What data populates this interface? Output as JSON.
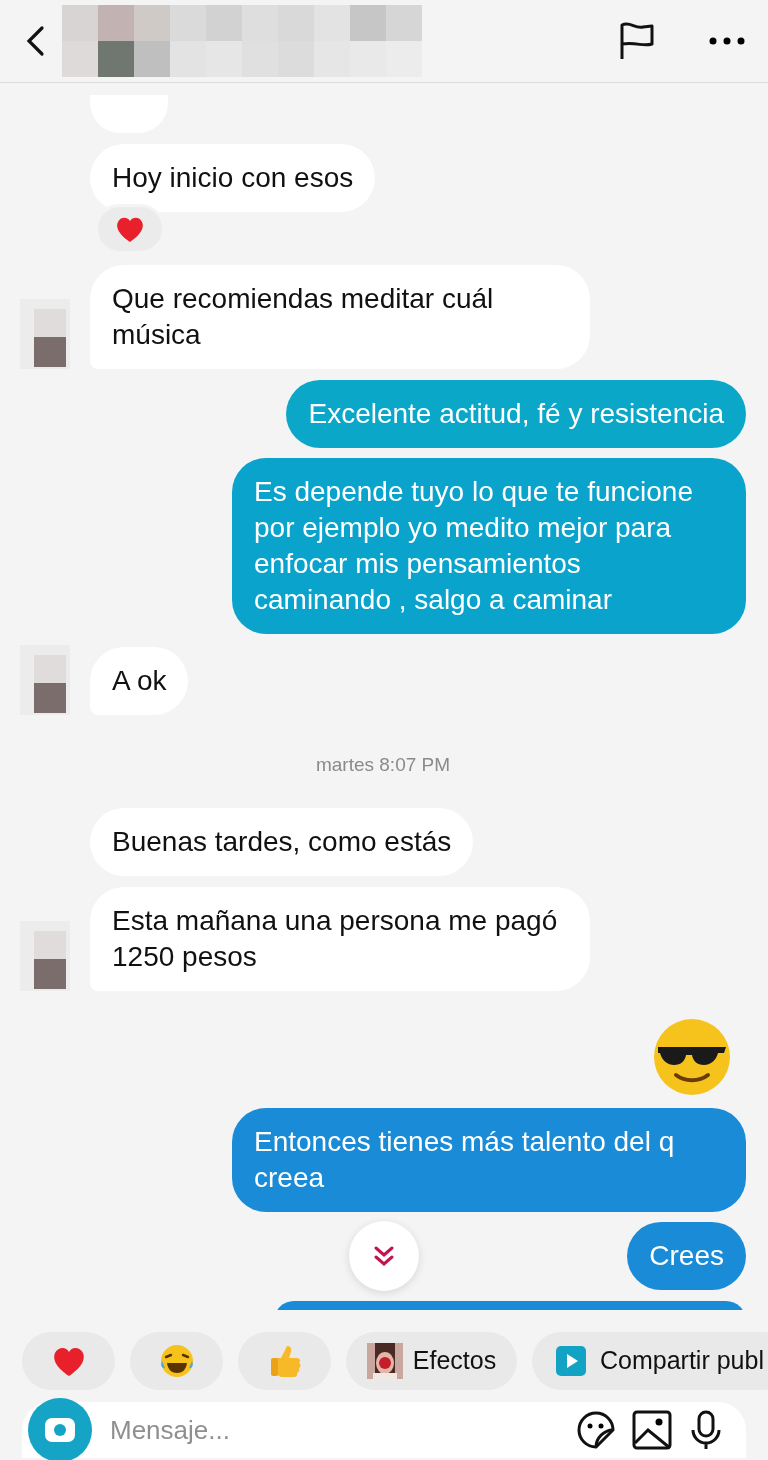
{
  "messages": [
    {
      "kind": "incoming-fragment"
    },
    {
      "kind": "incoming",
      "text": "Hoy inicio con esos",
      "avatar": false,
      "reaction": true
    },
    {
      "kind": "incoming",
      "text": "Que recomiendas meditar cuál música",
      "avatar": true,
      "reaction": false
    },
    {
      "kind": "outgoing",
      "text": "Excelente actitud, fé y resistencia",
      "color": "#0ba7c9"
    },
    {
      "kind": "outgoing",
      "text": "Es depende tuyo lo que te funcione por ejemplo yo medito mejor para enfocar mis pensamientos caminando , salgo a caminar",
      "color": "#0aa3cc"
    },
    {
      "kind": "incoming",
      "text": "A ok",
      "avatar": true,
      "reaction": false
    },
    {
      "kind": "timestamp",
      "text": "martes 8:07 PM"
    },
    {
      "kind": "incoming",
      "text": "Buenas tardes, como estás",
      "avatar": false,
      "reaction": false
    },
    {
      "kind": "incoming",
      "text": "Esta mañana una persona me pagó 1250 pesos",
      "avatar": true,
      "reaction": false
    },
    {
      "kind": "emoji"
    },
    {
      "kind": "outgoing",
      "text": "Entonces tienes más talento del q creea",
      "color": "#1a8bd6"
    },
    {
      "kind": "outgoing",
      "text": "Crees",
      "color": "#1a8bd6"
    },
    {
      "kind": "outgoing-fragment",
      "color": "#1a8bd6"
    }
  ],
  "quick_replies": [
    {
      "kind": "heart"
    },
    {
      "kind": "laugh"
    },
    {
      "kind": "thumb"
    },
    {
      "kind": "effects",
      "label": "Efectos"
    },
    {
      "kind": "share",
      "label": "Compartir publ"
    }
  ],
  "composer": {
    "placeholder": "Mensaje..."
  }
}
